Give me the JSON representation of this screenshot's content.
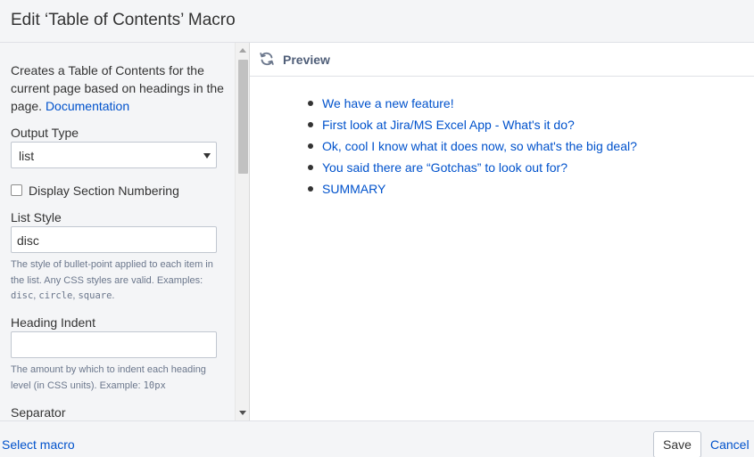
{
  "dialog": {
    "title": "Edit ‘Table of Contents’ Macro"
  },
  "left": {
    "description": "Creates a Table of Contents for the current page based on headings in the page.",
    "doc_link": "Documentation",
    "output_type_label": "Output Type",
    "output_type_value": "list",
    "section_numbering_label": "Display Section Numbering",
    "section_numbering_checked": false,
    "list_style_label": "List Style",
    "list_style_value": "disc",
    "list_style_help_1": "The style of bullet-point applied to each item in the list. Any CSS styles are valid. Examples: ",
    "list_style_help_code_1": "disc",
    "list_style_help_sep_1": ", ",
    "list_style_help_code_2": "circle",
    "list_style_help_sep_2": ", ",
    "list_style_help_code_3": "square",
    "list_style_help_end": ".",
    "heading_indent_label": "Heading Indent",
    "heading_indent_value": "",
    "heading_indent_help": "The amount by which to indent each heading level (in CSS units). Example: ",
    "heading_indent_help_code": "10px",
    "separator_label": "Separator"
  },
  "preview": {
    "label": "Preview",
    "items": [
      "We have a new feature!",
      "First look at Jira/MS Excel App - What's it do?",
      "Ok, cool I know what it does now, so what's the big deal?",
      "You said there are “Gotchas” to look out for?",
      "SUMMARY"
    ]
  },
  "footer": {
    "select_macro": "Select macro",
    "save": "Save",
    "cancel": "Cancel"
  },
  "colors": {
    "link": "#0052cc",
    "panel_bg": "#f4f5f7"
  }
}
